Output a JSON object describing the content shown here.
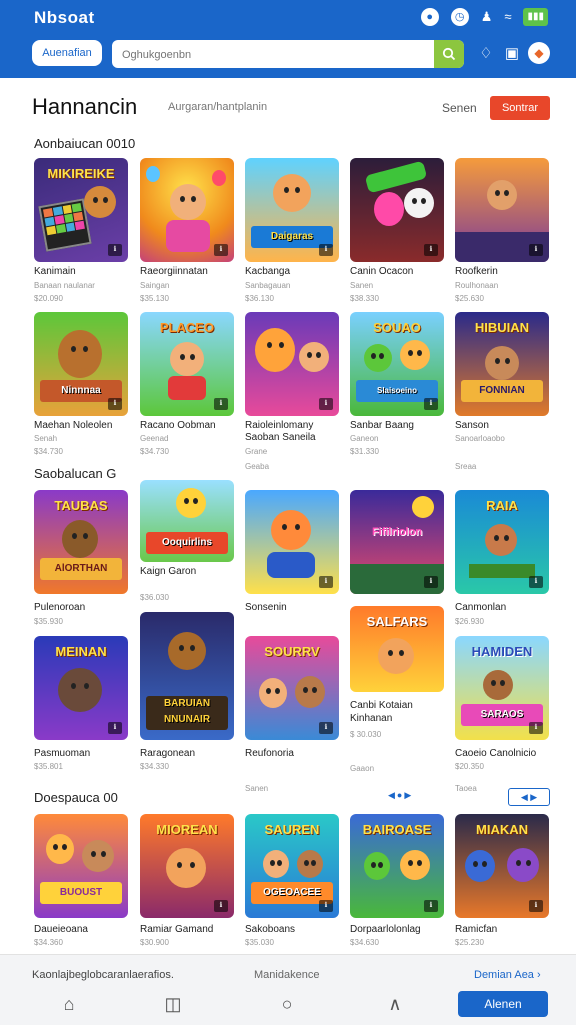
{
  "status": {
    "brand": "Nbsoat",
    "battery": "▮▮▮"
  },
  "toolbar": {
    "account_label": "Auenafian",
    "search_placeholder": "Oghukgoenbn",
    "avatar_glyph": "◆"
  },
  "header": {
    "title": "Hannancin",
    "subtitle": "Aurgaran/hantplanin",
    "sort_label": "Senen",
    "sort_button": "Sontrar"
  },
  "sections": [
    {
      "title": "Aonbaiucan 0010"
    },
    {
      "title": "Saobalucan G"
    },
    {
      "title": "Doespauca 00"
    }
  ],
  "tiles": [
    {
      "caption": "Kanimain",
      "meta": "Banaan naulanar",
      "price": "$20.090",
      "word": "MIKIREIKE",
      "banner": ""
    },
    {
      "caption": "Raeorgiinnatan",
      "meta": "Saingan",
      "price": "$35.130",
      "word": "",
      "banner": ""
    },
    {
      "caption": "Kacbanga",
      "meta": "Sanbagauan",
      "price": "$36.130",
      "word": "",
      "banner": "Daigaras"
    },
    {
      "caption": "Canin Ocacon",
      "meta": "Sanen",
      "price": "$38.330",
      "word": "",
      "banner": ""
    },
    {
      "caption": "Roofkerin",
      "meta": "Roulhonaan",
      "price": "$25.630",
      "word": "",
      "banner": ""
    },
    {
      "caption": "Maehan Noleolen",
      "meta": "Senah",
      "price": "$34.730",
      "word": "",
      "banner": "Ninnnaa"
    },
    {
      "caption": "Racano Oobman",
      "meta": "Geenad",
      "price": "$34.730",
      "word": "PLACEO",
      "banner": ""
    },
    {
      "caption": "Raioleinlomany",
      "caption2": "Saoban Saneila",
      "meta": "Grane",
      "price": "",
      "word": "",
      "banner": ""
    },
    {
      "caption": "Sanbar Baang",
      "meta": "Ganeon",
      "price": "$31.330",
      "word": "SOUAO",
      "banner": "Slaisoeino"
    },
    {
      "caption": "Sanson",
      "meta": "Sanoarloaobo",
      "price": "",
      "word": "HIBUIAN",
      "banner": "FONNIAN"
    },
    {
      "caption": "Pulenoroan",
      "meta": "",
      "price": "$35.930",
      "word": "TAUBAS",
      "banner": "AlORTHAN"
    },
    {
      "caption": "Kaign Garon",
      "meta": "",
      "price": "$36.030",
      "word": "",
      "banner": "Ooquirlins"
    },
    {
      "caption": "Sonsenin",
      "meta": "",
      "price": "",
      "word": "",
      "banner": ""
    },
    {
      "caption": "",
      "meta": "",
      "price": "",
      "word": "Fifilriolon",
      "banner": ""
    },
    {
      "caption": "Canmonlan",
      "meta": "",
      "price": "$26.930",
      "word": "RAIA",
      "banner": ""
    },
    {
      "caption": "Pasmuoman",
      "meta": "",
      "price": "$35.801",
      "word": "MEINAN",
      "banner": ""
    },
    {
      "caption": "Raragonean",
      "meta": "",
      "price": "$34.330",
      "word": "",
      "banner": "BARUIAN NNUNAIR"
    },
    {
      "caption": "Reufonoria",
      "meta": "Sanen",
      "price": "",
      "word": "SOURRV",
      "banner": ""
    },
    {
      "caption": "Canbi Kotaian",
      "caption2": "Kinhanan",
      "meta": "",
      "price": "$ 30.030",
      "word": "SALFARS",
      "banner": ""
    },
    {
      "caption": "Caoeio Canolnicio",
      "meta": "",
      "price": "$20.350",
      "word": "HAMIDEN",
      "banner": "SARAOS"
    },
    {
      "caption": "Daueieoana",
      "meta": "",
      "price": "$34.360",
      "word": "",
      "banner": "BUOUST"
    },
    {
      "caption": "Ramiar Gamand",
      "meta": "",
      "price": "$30.900",
      "word": "MIOREAN",
      "banner": ""
    },
    {
      "caption": "Sakoboans",
      "meta": "",
      "price": "$35.030",
      "word": "SAUREN",
      "banner": "OGEOACEE"
    },
    {
      "caption": "Dorpaarlolonlag",
      "meta": "",
      "price": "$34.630",
      "word": "BAIROASE",
      "banner": ""
    },
    {
      "caption": "Ramicfan",
      "meta": "",
      "price": "$25.230",
      "word": "MIAKAN",
      "banner": ""
    }
  ],
  "row_notes": {
    "r2_extra": "Geaba",
    "r2_extra_right": "Sreaa",
    "r4_meta_a": "Gaaon",
    "r4_meta_b": "Taoea"
  },
  "footer": {
    "left": "Kaonlajbeglobcaranlaerafios.",
    "mid": "Manidakence",
    "right": "Demian Aea",
    "cta": "Alenen"
  },
  "colors": {
    "brand_blue": "#1a66c9",
    "sort_red": "#e8472a",
    "search_green": "#8cc63f"
  }
}
